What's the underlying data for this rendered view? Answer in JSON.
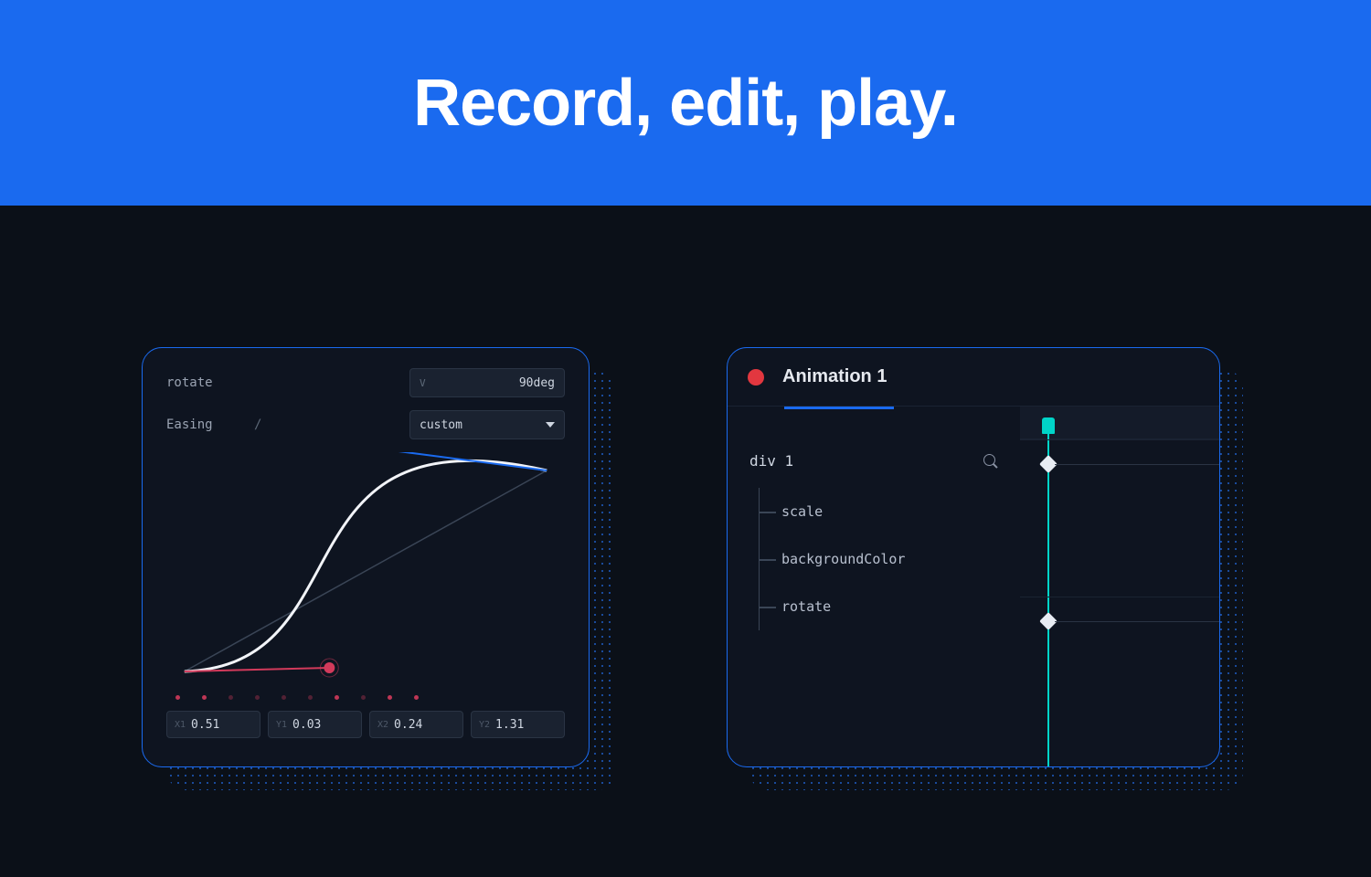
{
  "banner": {
    "headline": "Record, edit, play."
  },
  "easingPanel": {
    "rotate": {
      "label": "rotate",
      "indicator": "V",
      "value": "90deg"
    },
    "easing": {
      "label": "Easing",
      "separator": "/",
      "value": "custom"
    },
    "bezier": {
      "x1": {
        "key": "X1",
        "value": "0.51"
      },
      "y1": {
        "key": "Y1",
        "value": "0.03"
      },
      "x2": {
        "key": "X2",
        "value": "0.24"
      },
      "y2": {
        "key": "Y2",
        "value": "1.31"
      }
    }
  },
  "timelinePanel": {
    "title": "Animation 1",
    "element": "div 1",
    "properties": [
      "scale",
      "backgroundColor",
      "rotate"
    ]
  },
  "colors": {
    "accent": "#1a6aef",
    "record": "#e2373f",
    "playhead": "#00d4c8",
    "bg": "#0b1018"
  }
}
